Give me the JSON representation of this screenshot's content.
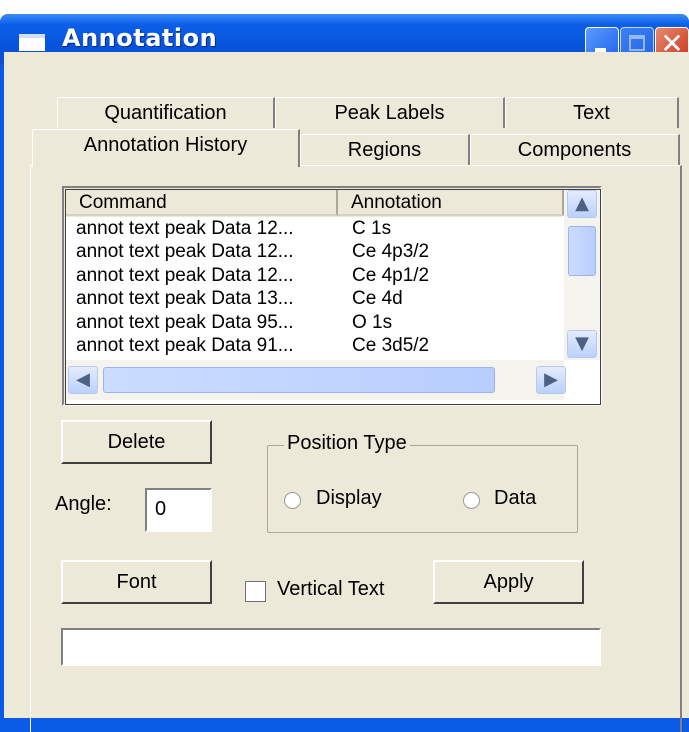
{
  "window": {
    "title": "Annotation"
  },
  "tabs": {
    "back_row": [
      "Quantification",
      "Peak Labels",
      "Text"
    ],
    "front_row": [
      "Annotation History",
      "Regions",
      "Components"
    ],
    "active": "Annotation History"
  },
  "history_list": {
    "columns": [
      "Command",
      "Annotation"
    ],
    "rows": [
      [
        "annot text peak Data 12...",
        "C 1s"
      ],
      [
        "annot text peak Data 12...",
        "Ce 4p3/2"
      ],
      [
        "annot text peak Data 12...",
        "Ce 4p1/2"
      ],
      [
        "annot text peak Data 13...",
        "Ce 4d"
      ],
      [
        "annot text peak Data 95...",
        "O 1s"
      ],
      [
        "annot text peak Data 91...",
        "Ce 3d5/2"
      ]
    ]
  },
  "buttons": {
    "delete": "Delete",
    "font": "Font",
    "apply": "Apply"
  },
  "angle": {
    "label": "Angle:",
    "value": "0"
  },
  "position_type": {
    "title": "Position Type",
    "options": [
      "Display",
      "Data"
    ],
    "selected": null
  },
  "vertical_text": {
    "label": "Vertical Text",
    "checked": false
  },
  "status_field": {
    "value": ""
  },
  "colors": {
    "titlebar": "#0654dc",
    "dialog_bg": "#ece9d8",
    "close_button": "#c8381c"
  },
  "icons": {
    "window": "window-icon",
    "minimize": "minimize-icon",
    "maximize": "maximize-icon",
    "close": "close-icon"
  }
}
